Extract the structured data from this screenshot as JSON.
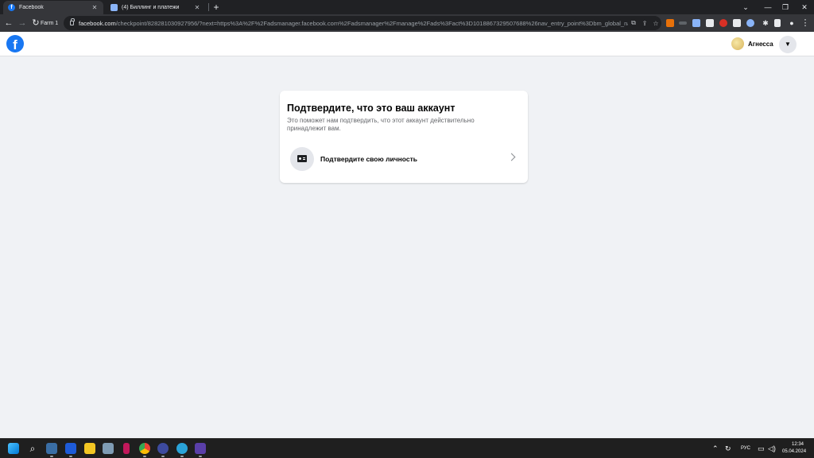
{
  "browser": {
    "tabs": [
      {
        "title": "Facebook",
        "favicon": "facebook-icon",
        "active": true
      },
      {
        "title": "(4) Биллинг и платежи",
        "favicon": "page-icon",
        "active": false
      }
    ],
    "profile_label": "Farm 1",
    "url_host": "facebook.com",
    "url_rest": "/checkpoint/828281030927956/?next=https%3A%2F%2Fadsmanager.facebook.com%2Fadsmanager%2Fmanage%2Fads%3Fact%3D1018867329507688%26nav_entry_point%3Dbm_global_nav..."
  },
  "header": {
    "logo_letter": "f",
    "user_name": "Агнесса"
  },
  "card": {
    "title": "Подтвердите, что это ваш аккаунт",
    "description": "Это поможет нам подтвердить, что этот аккаунт действительно принадлежит вам.",
    "option_label": "Подтвердите свою личность"
  },
  "taskbar": {
    "language": "РУС",
    "time": "12:34",
    "date": "05.04.2024"
  },
  "colors": {
    "facebook_blue": "#1877f2",
    "page_background": "#f0f2f5",
    "browser_dark": "#202124"
  }
}
